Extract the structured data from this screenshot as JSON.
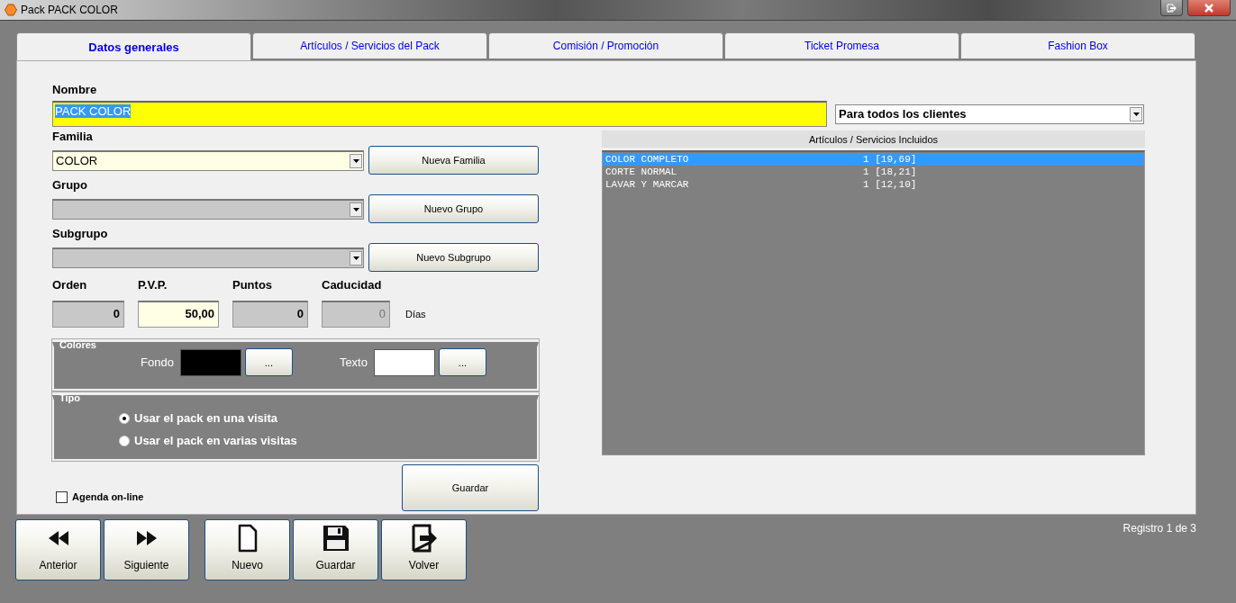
{
  "window": {
    "title": "Pack PACK COLOR"
  },
  "tabs": [
    {
      "label": "Datos generales",
      "selected": true
    },
    {
      "label": "Artículos / Servicios del Pack",
      "selected": false
    },
    {
      "label": "Comisión / Promoción",
      "selected": false
    },
    {
      "label": "Ticket Promesa",
      "selected": false
    },
    {
      "label": "Fashion Box",
      "selected": false
    }
  ],
  "name_field": {
    "label": "Nombre",
    "value": "PACK COLOR",
    "text_selected": true
  },
  "client_scope": {
    "value": "Para todos los clientes"
  },
  "categories": [
    {
      "label": "Familia",
      "value": "COLOR",
      "disabled": false,
      "button": "Nueva Familia"
    },
    {
      "label": "Grupo",
      "disabled": true,
      "button": "Nuevo Grupo"
    },
    {
      "label": "Subgrupo",
      "disabled": true,
      "button": "Nuevo Subgrupo"
    }
  ],
  "numbers": [
    {
      "label": "Orden",
      "value": "0",
      "disabled": true
    },
    {
      "label": "P.V.P.",
      "value": "50,00",
      "disabled": false
    },
    {
      "label": "Puntos",
      "value": "0",
      "disabled": true
    },
    {
      "label": "Caducidad",
      "value": "0",
      "disabled": true,
      "unit": "Días"
    }
  ],
  "colors": {
    "title": "Colores",
    "swatches": [
      {
        "label": "Fondo",
        "color": "#000000",
        "button": "..."
      },
      {
        "label": "Texto",
        "color": "#ffffff",
        "button": "..."
      }
    ]
  },
  "tipo": {
    "title": "Tipo",
    "options": [
      {
        "label": "Usar el pack en una visita",
        "selected": true
      },
      {
        "label": "Usar el pack en varias visitas",
        "selected": false
      }
    ]
  },
  "agenda": {
    "label": "Agenda on-line",
    "checked": false
  },
  "save_button": "Guardar",
  "included": {
    "title": "Artículos / Servicios Incluidos",
    "rows": [
      {
        "name": "COLOR COMPLETO",
        "detail": "1 [19,69]",
        "selected": true
      },
      {
        "name": "CORTE NORMAL",
        "detail": "1 [18,21]",
        "selected": false
      },
      {
        "name": "LAVAR Y MARCAR",
        "detail": "1 [12,10]",
        "selected": false
      }
    ]
  },
  "toolbar": [
    {
      "buttons": [
        {
          "label": "Anterior",
          "kind": "rewind"
        },
        {
          "label": "Siguiente",
          "kind": "forward"
        }
      ]
    },
    {
      "buttons": [
        {
          "label": "Nuevo",
          "kind": "document"
        },
        {
          "label": "Guardar",
          "kind": "save"
        },
        {
          "label": "Volver",
          "kind": "exit"
        }
      ]
    }
  ],
  "status": "Registro 1 de 3"
}
